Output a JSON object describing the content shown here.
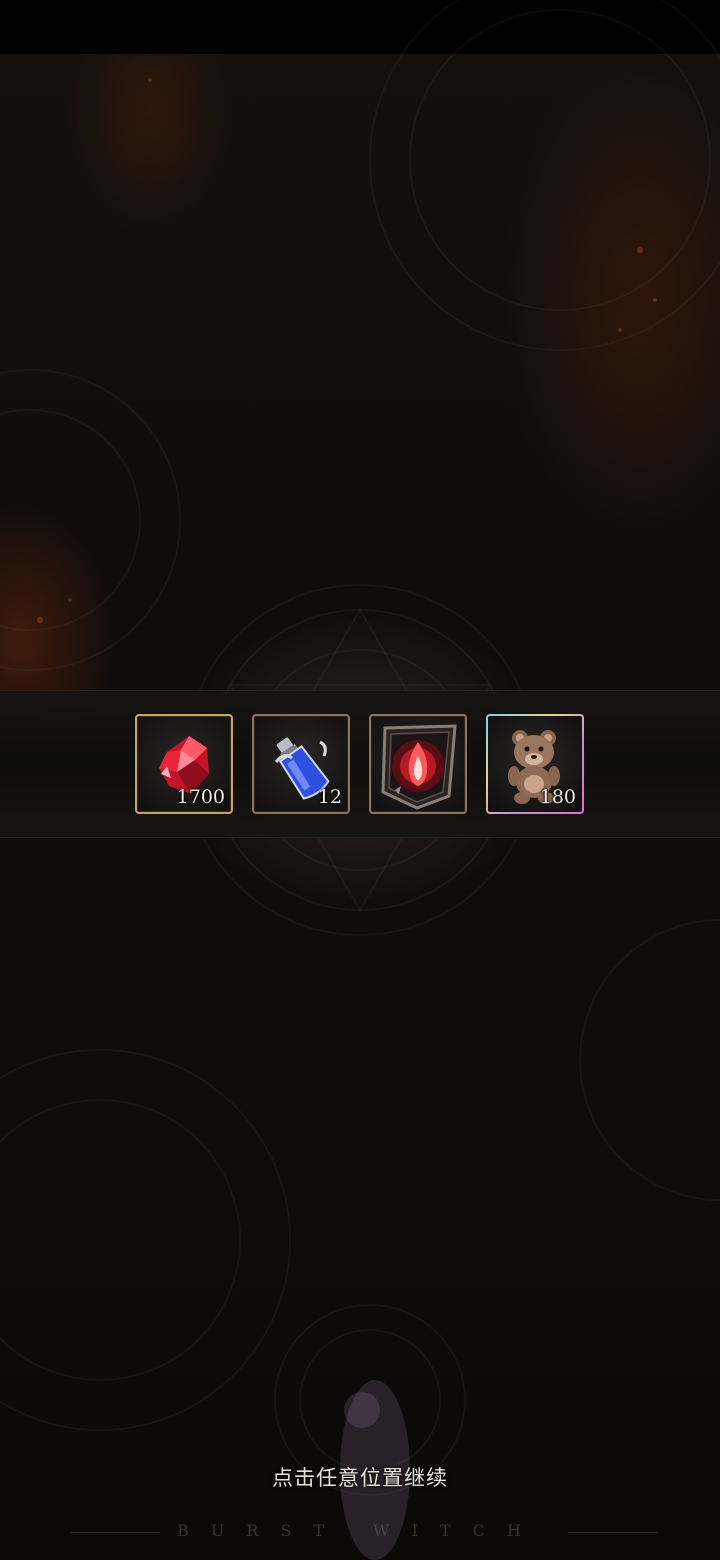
{
  "rewards": [
    {
      "name": "red crystal",
      "icon": "red-crystal-icon",
      "quantity": "1700",
      "frame": "gold"
    },
    {
      "name": "blue potion",
      "icon": "blue-potion-icon",
      "quantity": "12",
      "frame": "bronze"
    },
    {
      "name": "flame card",
      "icon": "flame-card-icon",
      "quantity": "",
      "frame": "bronze"
    },
    {
      "name": "teddy bear",
      "icon": "teddy-bear-icon",
      "quantity": "180",
      "frame": "rainbow"
    }
  ],
  "prompt": {
    "continue_text": "点击任意位置继续"
  },
  "brand": {
    "watermark": "BURST WITCH"
  },
  "colors": {
    "gold_frame": "#c9a45e",
    "bronze_frame": "#8c7460",
    "crystal": "#d8182e",
    "potion": "#3a5cf0"
  }
}
